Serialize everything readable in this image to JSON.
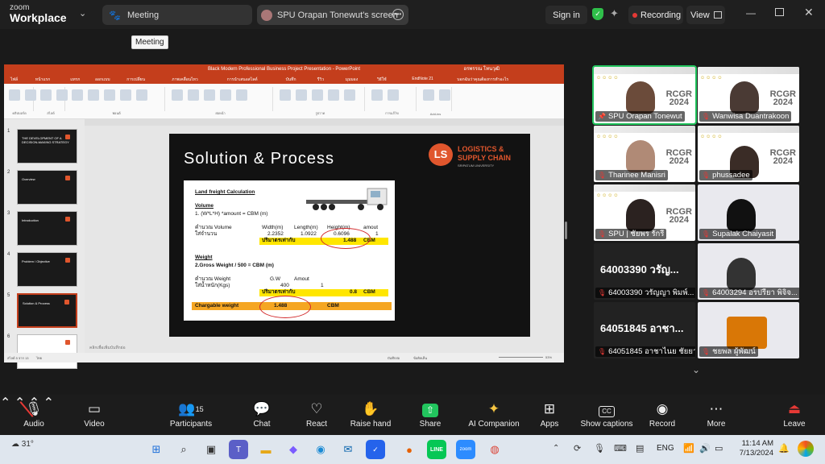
{
  "app": {
    "brand_top": "zoom",
    "brand_bottom": "Workplace"
  },
  "tabs": {
    "meeting_label": "Meeting",
    "tooltip": "Meeting",
    "screen_label": "SPU Orapan Tonewut's screen"
  },
  "header": {
    "signin": "Sign in",
    "recording": "Recording",
    "view": "View"
  },
  "ppt": {
    "window_title": "Black Modern Professional Business Project Presentation  -  PowerPoint",
    "user": "อรพรรณ โทนวุฒิ",
    "menu": [
      "ไฟล์",
      "หน้าแรก",
      "แทรก",
      "ออกแบบ",
      "การเปลี่ยน",
      "ภาพเคลื่อนไหว",
      "การนำเสนอสไลด์",
      "บันทึก",
      "รีวิว",
      "มุมมอง",
      "วิธีใช้",
      "EndNote 21",
      "บอกฉันว่าคุณต้องการทำอะไร"
    ],
    "ribbon_groups": [
      "คลิปบอร์ด",
      "สไลด์",
      "ฟอนต์",
      "ย่อหน้า",
      "รูปวาด",
      "การแก้ไข",
      "Add-ins"
    ],
    "status_left": "สไลด์ 5 จาก 13",
    "status_lang": "ไทย",
    "status_notes": "บันทึกย่อ",
    "status_comments": "ข้อคิดเห็น",
    "zoom": "53%",
    "notes_placeholder": "คลิกเพื่อเพิ่มบันทึกย่อ",
    "thumbs": [
      {
        "num": "1",
        "title": "THE DEVELOPMENT OF A DECISION-MAKING STRATEGY"
      },
      {
        "num": "2",
        "title": "Overview"
      },
      {
        "num": "3",
        "title": "Introduction"
      },
      {
        "num": "4",
        "title": "Problem / Objective"
      },
      {
        "num": "5",
        "title": "Solution & Process"
      },
      {
        "num": "6",
        "title": ""
      }
    ]
  },
  "slide": {
    "title": "Solution & Process",
    "logo_mark": "LS",
    "logo_line1": "LOGISTICS &",
    "logo_line2": "SUPPLY CHAIN",
    "logo_line3": "SRIPATUM UNIVERSITY",
    "sheet": {
      "heading": "Land freight Calculation",
      "volume_label": "Volume",
      "volume_formula": "1. (W*L*H) *amount = CBM (m)",
      "calc_volume": "คำนวณ Volume",
      "fill_amount": "ใส่จำนวน",
      "col_width": "Width(m)",
      "col_length": "Length(m)",
      "col_height": "Height(m)",
      "col_amount": "amout",
      "width": "2.2352",
      "length": "1.0922",
      "height": "0.6096",
      "amount": "1",
      "result_label": "ปริมาตรเท่ากับ",
      "result_volume": "1.488",
      "unit": "CBM",
      "weight_label": "Weight",
      "weight_formula": "2.Gross Weight / 500 = CBM (m)",
      "calc_weight": "คำนวณ Weight",
      "fill_weight": "ใส่น้ำหนัก(Kgs)",
      "col_gw": "G.W",
      "col_amount2": "Amout",
      "gw": "400",
      "amount2": "1",
      "result_weight": "0.8",
      "chargeable_label": "Chargable weight",
      "chargeable_value": "1.488"
    }
  },
  "participants": [
    {
      "name": "SPU Orapan Tonewut",
      "muted": false,
      "active": true
    },
    {
      "name": "Wanwisa Duantrakoon",
      "muted": true
    },
    {
      "name": "Tharinee Manisri",
      "muted": true
    },
    {
      "name": "phussadee",
      "muted": true
    },
    {
      "name": "SPU | ชัยพร รักรี",
      "muted": true
    },
    {
      "name": "Supalak Chaiyasit",
      "muted": true
    },
    {
      "name": "64003390 วรัญญา พิมพ์...",
      "big": "64003390 วรัญ...",
      "muted": true
    },
    {
      "name": "64003294 อรปรียา พิจิจ...",
      "muted": true
    },
    {
      "name": "64051845 อาชาไนย ชัยยา",
      "big": "64051845 อาชา...",
      "muted": true
    },
    {
      "name": "ชยพล ผู้พัฒน์",
      "muted": true
    }
  ],
  "toolbar": {
    "audio": "Audio",
    "video": "Video",
    "participants": "Participants",
    "participants_count": "15",
    "chat": "Chat",
    "react": "React",
    "raise_hand": "Raise hand",
    "share": "Share",
    "ai": "AI Companion",
    "apps": "Apps",
    "captions": "Show captions",
    "record": "Record",
    "more": "More",
    "leave": "Leave"
  },
  "taskbar": {
    "weather": "31°",
    "lang": "ENG",
    "time": "11:14 AM",
    "date": "7/13/2024"
  },
  "colors": {
    "accent_red": "#c43e1c",
    "recording_red": "#e53935",
    "share_green": "#22c55e"
  }
}
